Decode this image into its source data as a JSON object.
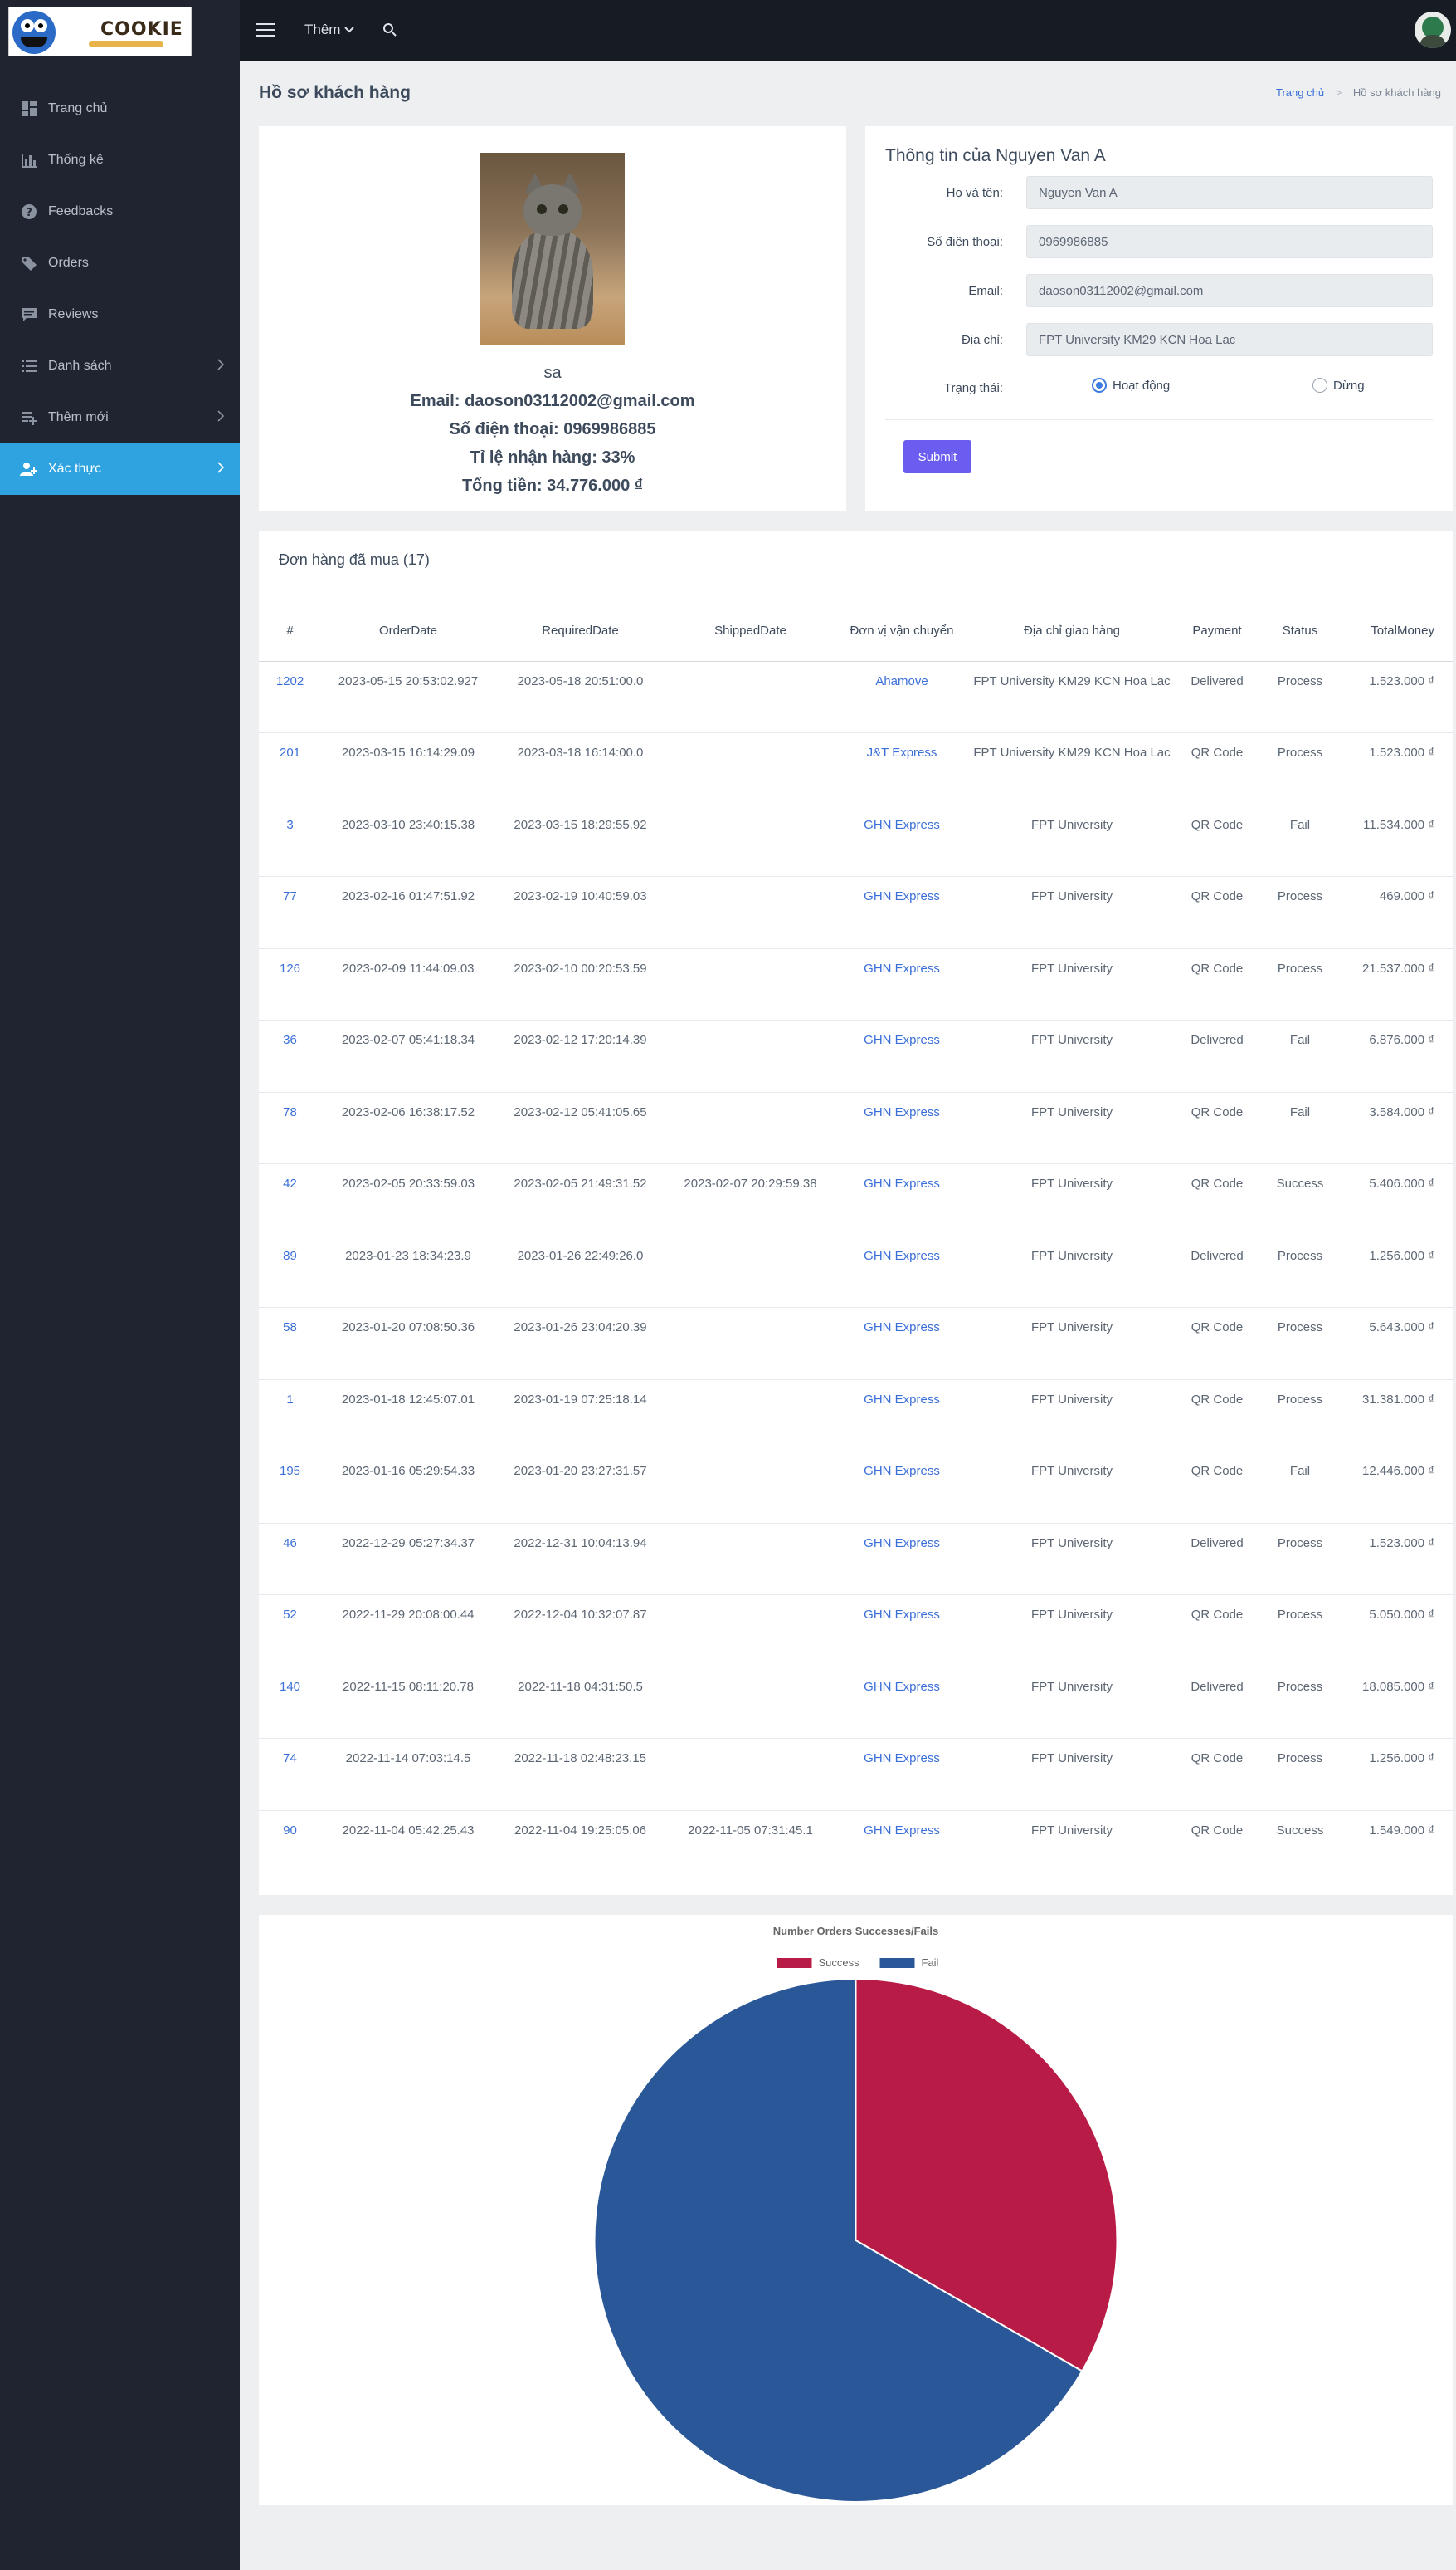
{
  "brand": {
    "logo_text": "COOKIE"
  },
  "sidebar": {
    "items": [
      {
        "label": "Trang chủ",
        "icon": "dashboard-icon"
      },
      {
        "label": "Thống kê",
        "icon": "bar-chart-icon"
      },
      {
        "label": "Feedbacks",
        "icon": "question-icon"
      },
      {
        "label": "Orders",
        "icon": "tag-icon"
      },
      {
        "label": "Reviews",
        "icon": "comment-icon"
      },
      {
        "label": "Danh sách",
        "icon": "list-icon"
      },
      {
        "label": "Thêm mới",
        "icon": "playlist-add-icon"
      },
      {
        "label": "Xác thực",
        "icon": "user-group-icon"
      }
    ]
  },
  "topbar": {
    "more_label": "Thêm"
  },
  "header": {
    "title": "Hồ sơ khách hàng",
    "breadcrumb_home": "Trang chủ",
    "breadcrumb_current": "Hồ sơ khách hàng"
  },
  "profile": {
    "name": "sa",
    "email_line": "Email: daoson03112002@gmail.com",
    "phone_line": "Số điện thoại: 0969986885",
    "rate_line": "Tỉ lệ nhận hàng: 33%",
    "total_line": "Tổng tiền: 34.776.000 ₫"
  },
  "info": {
    "title": "Thông tin của Nguyen Van A",
    "fullname_label": "Họ và tên:",
    "fullname_value": "Nguyen Van A",
    "phone_label": "Số điện thoại:",
    "phone_value": "0969986885",
    "email_label": "Email:",
    "email_value": "daoson03112002@gmail.com",
    "address_label": "Địa chỉ:",
    "address_value": "FPT University KM29 KCN Hoa Lac",
    "status_label": "Trạng thái:",
    "status_active": "Hoạt động",
    "status_stopped": "Dừng",
    "submit_label": "Submit"
  },
  "orders": {
    "title": "Đơn hàng đã mua (17)",
    "headers": [
      "#",
      "OrderDate",
      "RequiredDate",
      "ShippedDate",
      "Đơn vị vận chuyển",
      "Địa chỉ giao hàng",
      "Payment",
      "Status",
      "TotalMoney"
    ],
    "rows": [
      {
        "id": "1202",
        "order_date": "2023-05-15 20:53:02.927",
        "required_date": "2023-05-18 20:51:00.0",
        "shipped_date": "",
        "shipper": "Ahamove",
        "address": "FPT University KM29 KCN Hoa Lac",
        "payment": "Delivered",
        "status": "Process",
        "total": "1.523.000 ₫"
      },
      {
        "id": "201",
        "order_date": "2023-03-15 16:14:29.09",
        "required_date": "2023-03-18 16:14:00.0",
        "shipped_date": "",
        "shipper": "J&T Express",
        "address": "FPT University KM29 KCN Hoa Lac",
        "payment": "QR Code",
        "status": "Process",
        "total": "1.523.000 ₫"
      },
      {
        "id": "3",
        "order_date": "2023-03-10 23:40:15.38",
        "required_date": "2023-03-15 18:29:55.92",
        "shipped_date": "",
        "shipper": "GHN Express",
        "address": "FPT University",
        "payment": "QR Code",
        "status": "Fail",
        "total": "11.534.000 ₫"
      },
      {
        "id": "77",
        "order_date": "2023-02-16 01:47:51.92",
        "required_date": "2023-02-19 10:40:59.03",
        "shipped_date": "",
        "shipper": "GHN Express",
        "address": "FPT University",
        "payment": "QR Code",
        "status": "Process",
        "total": "469.000 ₫"
      },
      {
        "id": "126",
        "order_date": "2023-02-09 11:44:09.03",
        "required_date": "2023-02-10 00:20:53.59",
        "shipped_date": "",
        "shipper": "GHN Express",
        "address": "FPT University",
        "payment": "QR Code",
        "status": "Process",
        "total": "21.537.000 ₫"
      },
      {
        "id": "36",
        "order_date": "2023-02-07 05:41:18.34",
        "required_date": "2023-02-12 17:20:14.39",
        "shipped_date": "",
        "shipper": "GHN Express",
        "address": "FPT University",
        "payment": "Delivered",
        "status": "Fail",
        "total": "6.876.000 ₫"
      },
      {
        "id": "78",
        "order_date": "2023-02-06 16:38:17.52",
        "required_date": "2023-02-12 05:41:05.65",
        "shipped_date": "",
        "shipper": "GHN Express",
        "address": "FPT University",
        "payment": "QR Code",
        "status": "Fail",
        "total": "3.584.000 ₫"
      },
      {
        "id": "42",
        "order_date": "2023-02-05 20:33:59.03",
        "required_date": "2023-02-05 21:49:31.52",
        "shipped_date": "2023-02-07 20:29:59.38",
        "shipper": "GHN Express",
        "address": "FPT University",
        "payment": "QR Code",
        "status": "Success",
        "total": "5.406.000 ₫"
      },
      {
        "id": "89",
        "order_date": "2023-01-23 18:34:23.9",
        "required_date": "2023-01-26 22:49:26.0",
        "shipped_date": "",
        "shipper": "GHN Express",
        "address": "FPT University",
        "payment": "Delivered",
        "status": "Process",
        "total": "1.256.000 ₫"
      },
      {
        "id": "58",
        "order_date": "2023-01-20 07:08:50.36",
        "required_date": "2023-01-26 23:04:20.39",
        "shipped_date": "",
        "shipper": "GHN Express",
        "address": "FPT University",
        "payment": "QR Code",
        "status": "Process",
        "total": "5.643.000 ₫"
      },
      {
        "id": "1",
        "order_date": "2023-01-18 12:45:07.01",
        "required_date": "2023-01-19 07:25:18.14",
        "shipped_date": "",
        "shipper": "GHN Express",
        "address": "FPT University",
        "payment": "QR Code",
        "status": "Process",
        "total": "31.381.000 ₫"
      },
      {
        "id": "195",
        "order_date": "2023-01-16 05:29:54.33",
        "required_date": "2023-01-20 23:27:31.57",
        "shipped_date": "",
        "shipper": "GHN Express",
        "address": "FPT University",
        "payment": "QR Code",
        "status": "Fail",
        "total": "12.446.000 ₫"
      },
      {
        "id": "46",
        "order_date": "2022-12-29 05:27:34.37",
        "required_date": "2022-12-31 10:04:13.94",
        "shipped_date": "",
        "shipper": "GHN Express",
        "address": "FPT University",
        "payment": "Delivered",
        "status": "Process",
        "total": "1.523.000 ₫"
      },
      {
        "id": "52",
        "order_date": "2022-11-29 20:08:00.44",
        "required_date": "2022-12-04 10:32:07.87",
        "shipped_date": "",
        "shipper": "GHN Express",
        "address": "FPT University",
        "payment": "QR Code",
        "status": "Process",
        "total": "5.050.000 ₫"
      },
      {
        "id": "140",
        "order_date": "2022-11-15 08:11:20.78",
        "required_date": "2022-11-18 04:31:50.5",
        "shipped_date": "",
        "shipper": "GHN Express",
        "address": "FPT University",
        "payment": "Delivered",
        "status": "Process",
        "total": "18.085.000 ₫"
      },
      {
        "id": "74",
        "order_date": "2022-11-14 07:03:14.5",
        "required_date": "2022-11-18 02:48:23.15",
        "shipped_date": "",
        "shipper": "GHN Express",
        "address": "FPT University",
        "payment": "QR Code",
        "status": "Process",
        "total": "1.256.000 ₫"
      },
      {
        "id": "90",
        "order_date": "2022-11-04 05:42:25.43",
        "required_date": "2022-11-04 19:25:05.06",
        "shipped_date": "2022-11-05 07:31:45.1",
        "shipper": "GHN Express",
        "address": "FPT University",
        "payment": "QR Code",
        "status": "Success",
        "total": "1.549.000 ₫"
      }
    ]
  },
  "chart_data": {
    "type": "pie",
    "title": "Number Orders Successes/Fails",
    "categories": [
      "Success",
      "Fail"
    ],
    "values": [
      2,
      4
    ],
    "colors": [
      "#b81c46",
      "#2a5798"
    ],
    "legend_position": "top"
  }
}
